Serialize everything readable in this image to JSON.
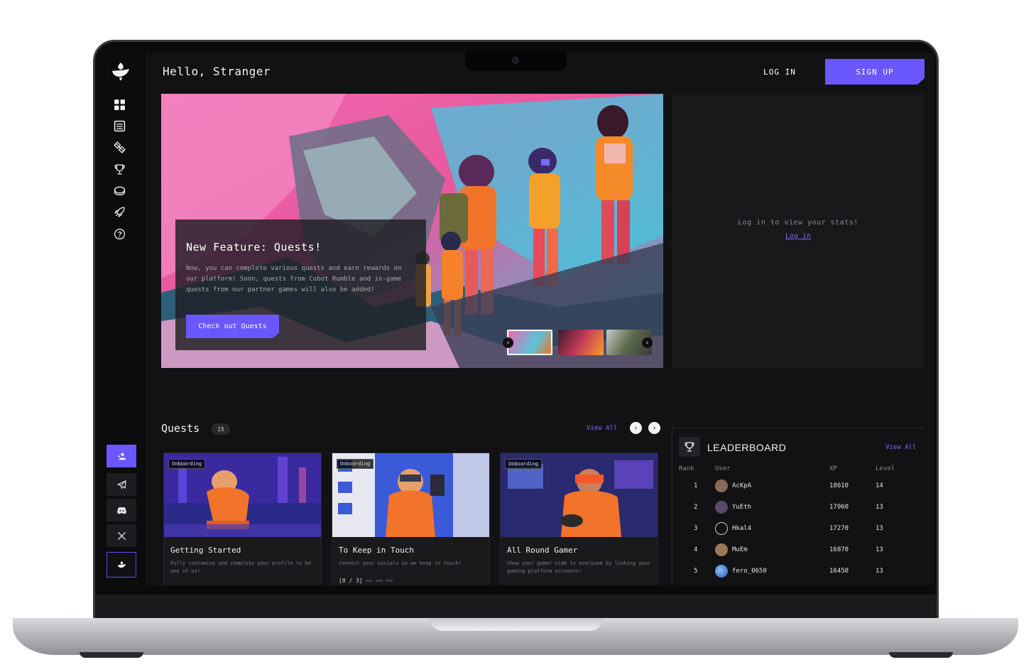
{
  "header": {
    "greeting": "Hello, Stranger",
    "login_label": "LOG IN",
    "signup_label": "SIGN UP"
  },
  "sidebar": {
    "nav_icons": [
      "grid-icon",
      "list-icon",
      "satellite-icon",
      "trophy-icon",
      "disc-icon",
      "rocket-icon",
      "help-icon"
    ],
    "social_icons": [
      "profile-icon",
      "telegram-icon",
      "discord-icon",
      "x-icon",
      "brand-icon"
    ]
  },
  "hero": {
    "title": "New Feature: Quests!",
    "text": "Now, you can complete various quests and earn rewards on our platform! Soon, quests from Cobot Rumble and in-game quests from our partner games will also be added!",
    "button_label": "Check out Quests",
    "prev_icon": "‹",
    "next_icon": "›"
  },
  "stats": {
    "message": "Log in to view your stats!",
    "link_label": "Log in"
  },
  "quests": {
    "title": "Quests",
    "count": "15",
    "view_all": "View All",
    "prev_icon": "‹",
    "next_icon": "›",
    "cards": [
      {
        "tag": "Onboarding",
        "title": "Getting Started",
        "desc": "Fully customize and complete your profile to be one of us!",
        "progress": ""
      },
      {
        "tag": "Onboarding",
        "title": "To Keep in Touch",
        "desc": "Connect your socials so we keep in touch!",
        "progress": "[0 / 3]"
      },
      {
        "tag": "Onboarding",
        "title": "All Round Gamer",
        "desc": "Show your gamer side to everyone by linking your gaming platform accounts!",
        "progress": ""
      }
    ]
  },
  "leaderboard": {
    "title": "LEADERBOARD",
    "view_all": "View All",
    "columns": [
      "Rank",
      "User",
      "XP",
      "Level"
    ],
    "rows": [
      {
        "rank": "1",
        "user": "AcKpA",
        "xp": "18610",
        "level": "14",
        "avatar_color": "#8a6a5a"
      },
      {
        "rank": "2",
        "user": "YuEth",
        "xp": "17960",
        "level": "13",
        "avatar_color": "#5a4a6a"
      },
      {
        "rank": "3",
        "user": "Hkal4",
        "xp": "17270",
        "level": "13",
        "avatar_color": "#cccccc"
      },
      {
        "rank": "4",
        "user": "MuEm",
        "xp": "16870",
        "level": "13",
        "avatar_color": "#9a7a5a"
      },
      {
        "rank": "5",
        "user": "fero_0650",
        "xp": "16450",
        "level": "13",
        "avatar_color": "#3a7ad0"
      }
    ]
  },
  "colors": {
    "accent": "#6a57ff",
    "background": "#121214",
    "panel": "#19191c"
  }
}
